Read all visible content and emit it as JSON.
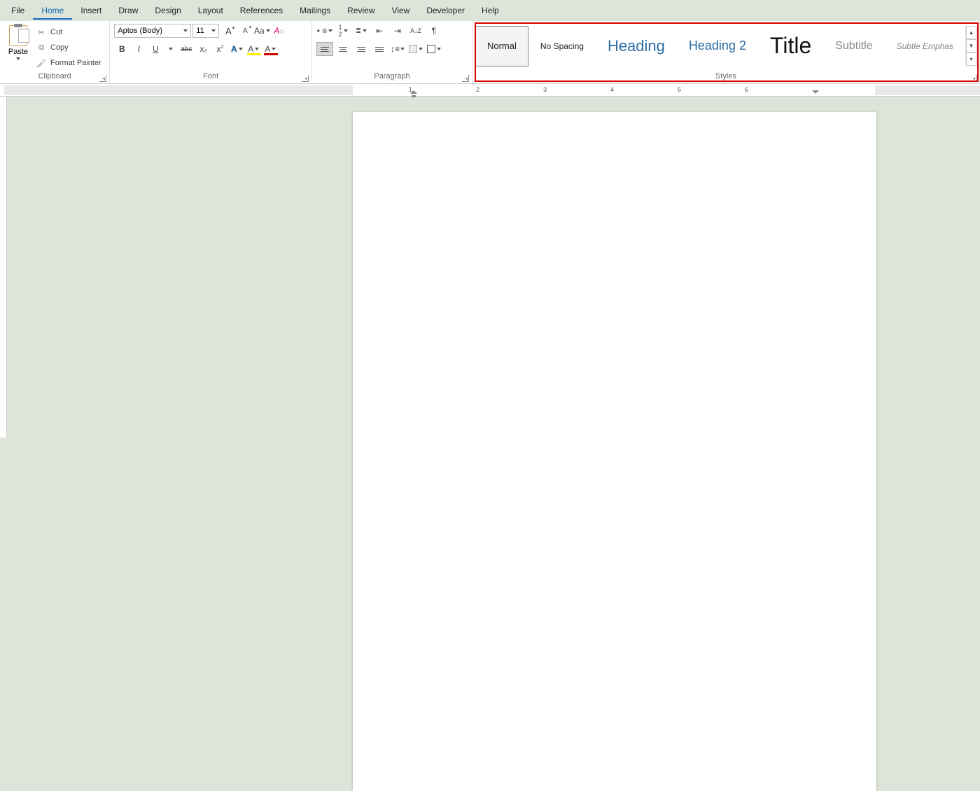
{
  "menu": {
    "file": "File",
    "home": "Home",
    "insert": "Insert",
    "draw": "Draw",
    "design": "Design",
    "layout": "Layout",
    "references": "References",
    "mailings": "Mailings",
    "review": "Review",
    "view": "View",
    "developer": "Developer",
    "help": "Help"
  },
  "clipboard": {
    "paste": "Paste",
    "cut": "Cut",
    "copy": "Copy",
    "format_painter": "Format Painter",
    "label": "Clipboard"
  },
  "font": {
    "name": "Aptos (Body)",
    "size": "11",
    "label": "Font",
    "bold": "B",
    "italic": "I",
    "underline": "U",
    "strike": "abc",
    "sub": "x",
    "sup": "x",
    "caseAa": "Aa",
    "textfx": "A",
    "highlight": "A",
    "color": "A",
    "grow": "A",
    "shrink": "A",
    "clear": "A"
  },
  "paragraph": {
    "label": "Paragraph",
    "sort": "A↓Z",
    "show": "¶"
  },
  "styles": {
    "label": "Styles",
    "items": [
      {
        "name": "Normal",
        "cls": "style-normal",
        "selected": true
      },
      {
        "name": "No Spacing",
        "cls": "style-nospace"
      },
      {
        "name": "Heading",
        "cls": "style-h1"
      },
      {
        "name": "Heading 2",
        "cls": "style-h2"
      },
      {
        "name": "Title",
        "cls": "style-title"
      },
      {
        "name": "Subtitle",
        "cls": "style-sub"
      },
      {
        "name": "Subtle Emphas",
        "cls": "style-emph"
      }
    ]
  },
  "ruler": {
    "marks": [
      "1",
      "2",
      "3",
      "4",
      "5",
      "6"
    ]
  }
}
